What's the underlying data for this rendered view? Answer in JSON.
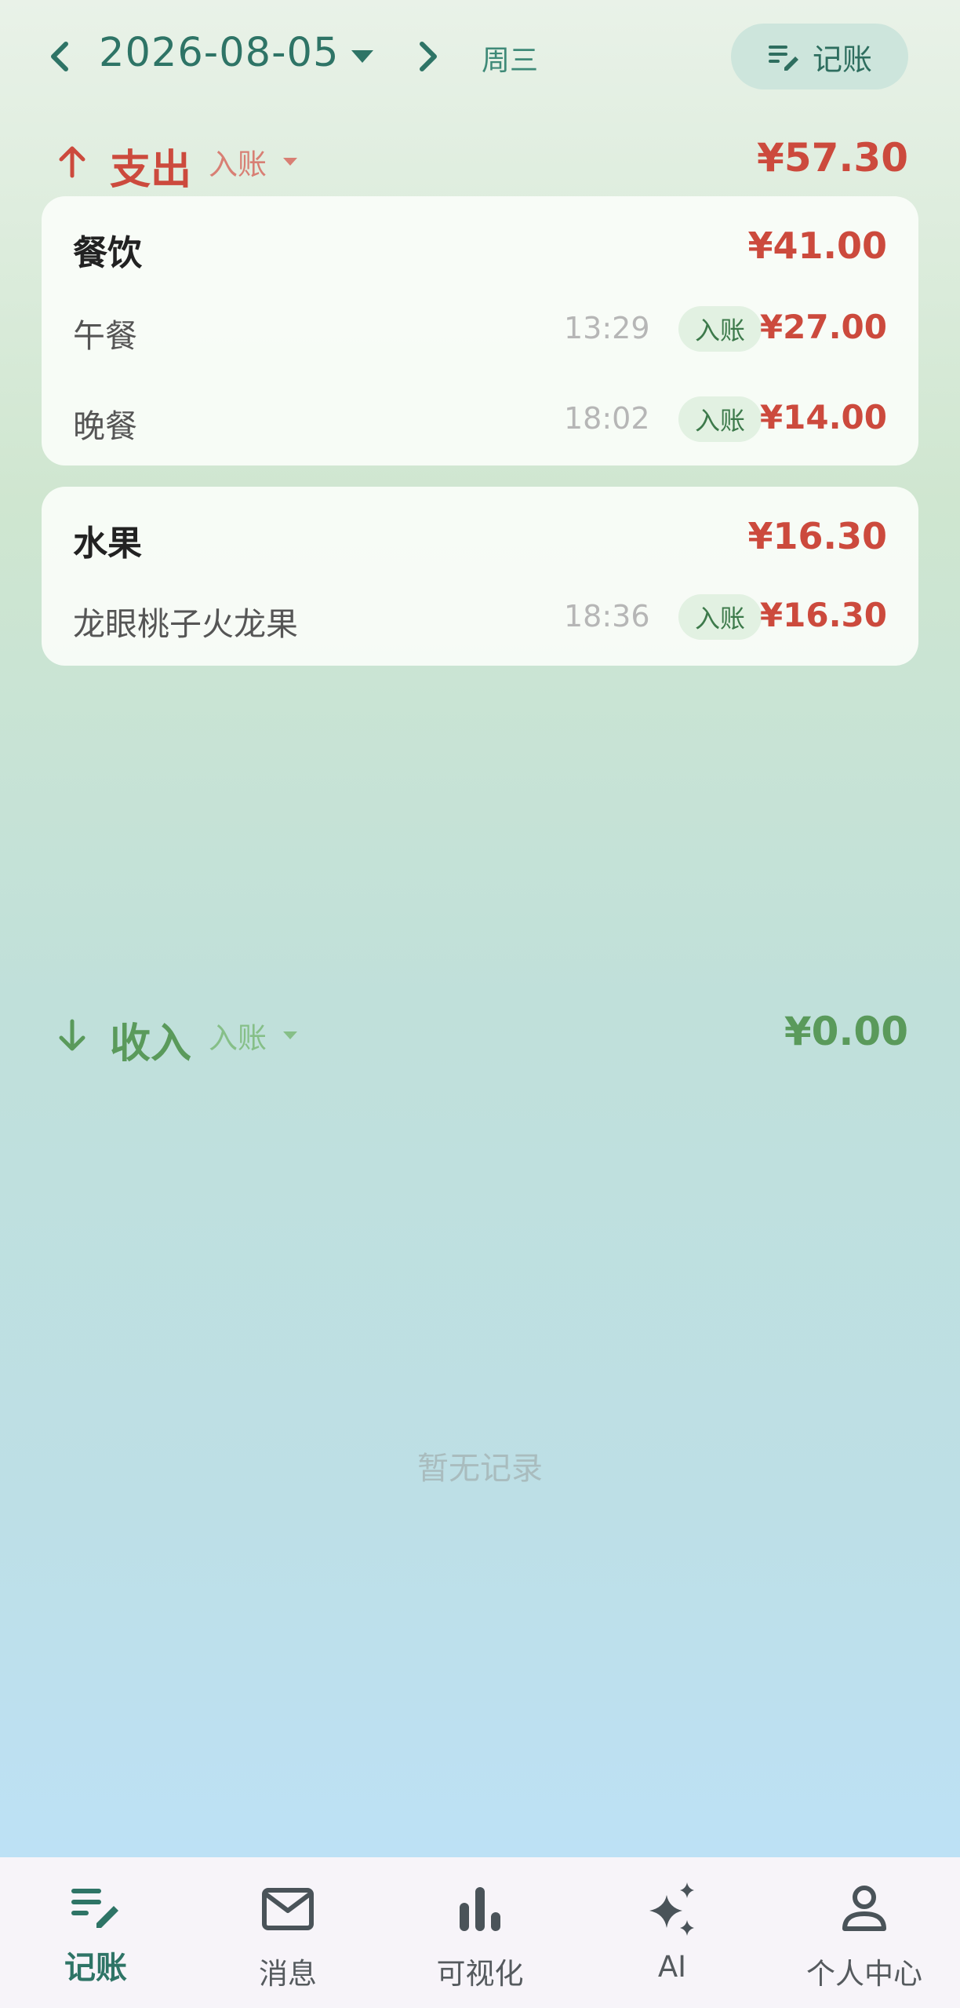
{
  "header": {
    "date": "2026-08-05",
    "weekday": "周三",
    "record_button": "记账"
  },
  "expense": {
    "title": "支出",
    "filter": "入账",
    "total": "¥57.30",
    "categories": [
      {
        "name": "餐饮",
        "total": "¥41.00",
        "items": [
          {
            "name": "午餐",
            "time": "13:29",
            "badge": "入账",
            "amount": "¥27.00"
          },
          {
            "name": "晚餐",
            "time": "18:02",
            "badge": "入账",
            "amount": "¥14.00"
          }
        ]
      },
      {
        "name": "水果",
        "total": "¥16.30",
        "items": [
          {
            "name": "龙眼桃子火龙果",
            "time": "18:36",
            "badge": "入账",
            "amount": "¥16.30"
          }
        ]
      }
    ]
  },
  "income": {
    "title": "收入",
    "filter": "入账",
    "total": "¥0.00",
    "empty_text": "暂无记录"
  },
  "nav": {
    "items": [
      {
        "label": "记账",
        "icon": "edit-note-icon"
      },
      {
        "label": "消息",
        "icon": "mail-icon"
      },
      {
        "label": "可视化",
        "icon": "bar-chart-icon"
      },
      {
        "label": "AI",
        "icon": "sparkle-icon"
      },
      {
        "label": "个人中心",
        "icon": "person-icon"
      }
    ]
  },
  "colors": {
    "accent": "#2e7466",
    "expense": "#cc4a3d",
    "income": "#5a9a5b"
  }
}
